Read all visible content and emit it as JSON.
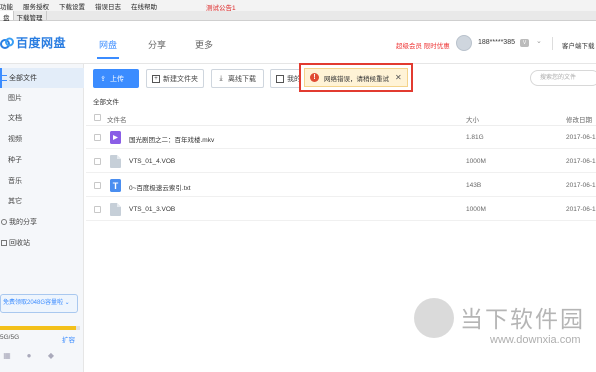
{
  "menubar": {
    "items": [
      "功能",
      "服务授权",
      "下载设置",
      "错误日志",
      "在线帮助"
    ],
    "notice": "测试公告1"
  },
  "window_tabs": [
    "盘",
    "下载管理"
  ],
  "header": {
    "logo_text": "百度网盘",
    "nav": [
      "网盘",
      "分享",
      "更多"
    ],
    "active_nav": "网盘",
    "vip_link": "超级会员 限时优惠",
    "username": "188*****385",
    "client_link": "客户端下载"
  },
  "sidebar": {
    "items": [
      "全部文件",
      "图片",
      "文档",
      "视频",
      "种子",
      "音乐",
      "其它",
      "我的分享",
      "回收站"
    ],
    "active": "全部文件",
    "quota_promo": "免费领取2048G容量啦",
    "quota_used_fraction": 0.95,
    "quota_text": "5G/5G",
    "expand_label": "扩容"
  },
  "toolbar": {
    "upload": "上传",
    "new_folder": "新建文件夹",
    "offline_download": "离线下载",
    "fourth_button": "我的",
    "search_placeholder": "搜索您的文件"
  },
  "breadcrumb": "全部文件",
  "table": {
    "columns": [
      "文件名",
      "大小",
      "修改日期"
    ],
    "rows": [
      {
        "name": "国光剧团之二：百年戏楼.mkv",
        "size": "1.81G",
        "date": "2017-06-1",
        "type": "video"
      },
      {
        "name": "VTS_01_4.VOB",
        "size": "1000M",
        "date": "2017-06-1",
        "type": "file"
      },
      {
        "name": "0~百度极速云索引.txt",
        "size": "143B",
        "date": "2017-06-1",
        "type": "txt"
      },
      {
        "name": "VTS_01_3.VOB",
        "size": "1000M",
        "date": "2017-06-1",
        "type": "file"
      }
    ]
  },
  "toast": {
    "message": "网络错误，请稍候重试",
    "close": "✕",
    "icon": "!"
  },
  "watermark": {
    "title": "当下软件园",
    "url": "www.downxia.com"
  },
  "colors": {
    "accent": "#3b8cff",
    "error": "#e23b30",
    "toast_bg": "#fff3d6",
    "vip": "#e33333",
    "quota_fill": "#f3c01a"
  }
}
